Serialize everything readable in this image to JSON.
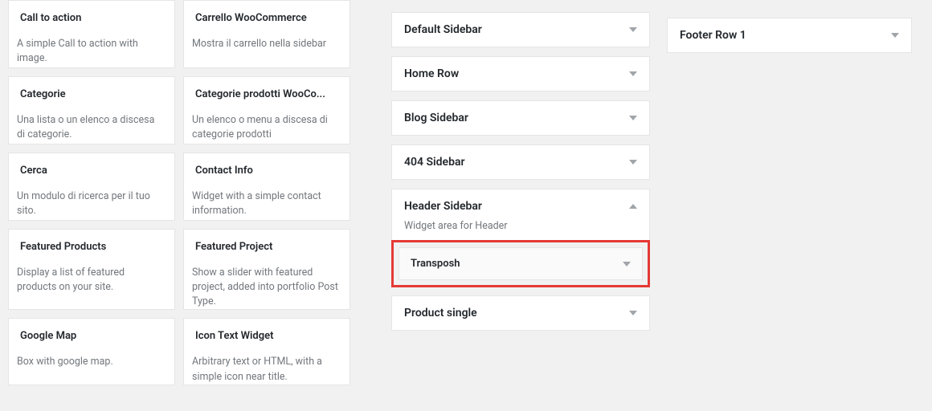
{
  "widgets": [
    {
      "title": "Call to action",
      "desc": "A simple Call to action with image."
    },
    {
      "title": "Carrello WooCommerce",
      "desc": "Mostra il carrello nella sidebar"
    },
    {
      "title": "Categorie",
      "desc": "Una lista o un elenco a discesa di categorie."
    },
    {
      "title": "Categorie prodotti WooCo...",
      "desc": "Un elenco o menu a discesa di categorie prodotti"
    },
    {
      "title": "Cerca",
      "desc": "Un modulo di ricerca per il tuo sito."
    },
    {
      "title": "Contact Info",
      "desc": "Widget with a simple contact information."
    },
    {
      "title": "Featured Products",
      "desc": "Display a list of featured products on your site."
    },
    {
      "title": "Featured Project",
      "desc": "Show a slider with featured project, added into portfolio Post Type."
    },
    {
      "title": "Google Map",
      "desc": "Box with google map."
    },
    {
      "title": "Icon Text Widget",
      "desc": "Arbitrary text or HTML, with a simple icon near title."
    }
  ],
  "areas": {
    "default_sidebar": "Default Sidebar",
    "home_row": "Home Row",
    "blog_sidebar": "Blog Sidebar",
    "sidebar_404": "404 Sidebar",
    "header_sidebar": "Header Sidebar",
    "header_desc": "Widget area for Header",
    "product_single": "Product single",
    "footer_row_1": "Footer Row 1"
  },
  "inner_widget": {
    "title": "Transposh"
  }
}
